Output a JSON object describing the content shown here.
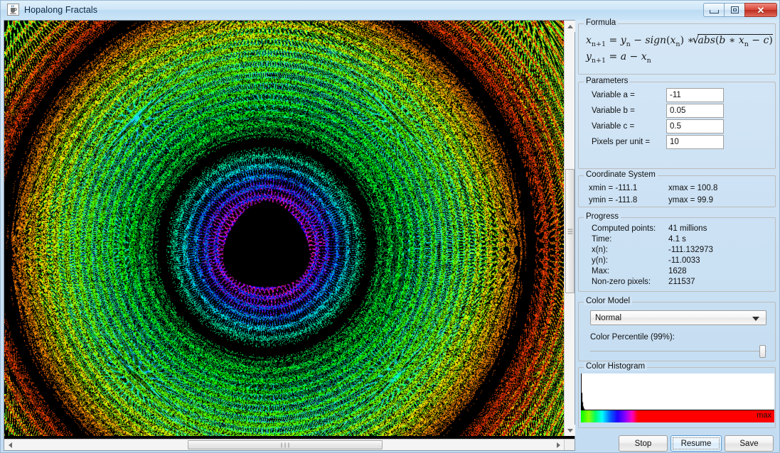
{
  "window": {
    "title": "Hopalong Fractals",
    "icon": "java-coffee-cup-icon",
    "controls": {
      "minimize": "minimize-icon",
      "maximize": "restore-icon",
      "close": "close-icon"
    }
  },
  "formula": {
    "legend": "Formula",
    "line1": "x(n+1) = y(n) − sign(x(n)) * √abs(b * x(n) − c)",
    "line2": "y(n+1) = a − x(n)"
  },
  "parameters": {
    "legend": "Parameters",
    "rows": [
      {
        "label": "Variable a =",
        "value": "-11"
      },
      {
        "label": "Variable b =",
        "value": "0.05"
      },
      {
        "label": "Variable c =",
        "value": "0.5"
      },
      {
        "label": "Pixels per unit =",
        "value": "10"
      }
    ]
  },
  "coordinate_system": {
    "legend": "Coordinate System",
    "xmin": "xmin = -111.1",
    "xmax": "xmax = 100.8",
    "ymin": "ymin = -111.8",
    "ymax": "ymax = 99.9"
  },
  "progress": {
    "legend": "Progress",
    "rows": [
      {
        "label": "Computed points:",
        "value": "41 millions"
      },
      {
        "label": "Time:",
        "value": "4.1 s"
      },
      {
        "label": "x(n):",
        "value": "-111.132973"
      },
      {
        "label": "y(n):",
        "value": "-11.0033"
      },
      {
        "label": "Max:",
        "value": "1628"
      },
      {
        "label": "Non-zero pixels:",
        "value": "211537"
      }
    ]
  },
  "color_model": {
    "legend": "Color Model",
    "selected": "Normal",
    "options": [
      "Normal"
    ],
    "percentile_label": "Color Percentile (99%):",
    "percentile_value": 100
  },
  "color_histogram": {
    "legend": "Color Histogram",
    "max_label": "max"
  },
  "buttons": {
    "stop": "Stop",
    "resume": "Resume",
    "save": "Save"
  },
  "colors": {
    "accent": "#5f9bd0",
    "panel": "#cfe3f4",
    "close_red": "#d9483b",
    "canvas_bg": "#000000"
  },
  "fractal": {
    "name": "hopalong-attractor-render",
    "description": "Hopalong attractor plotted with rainbow density colouring on black background"
  }
}
